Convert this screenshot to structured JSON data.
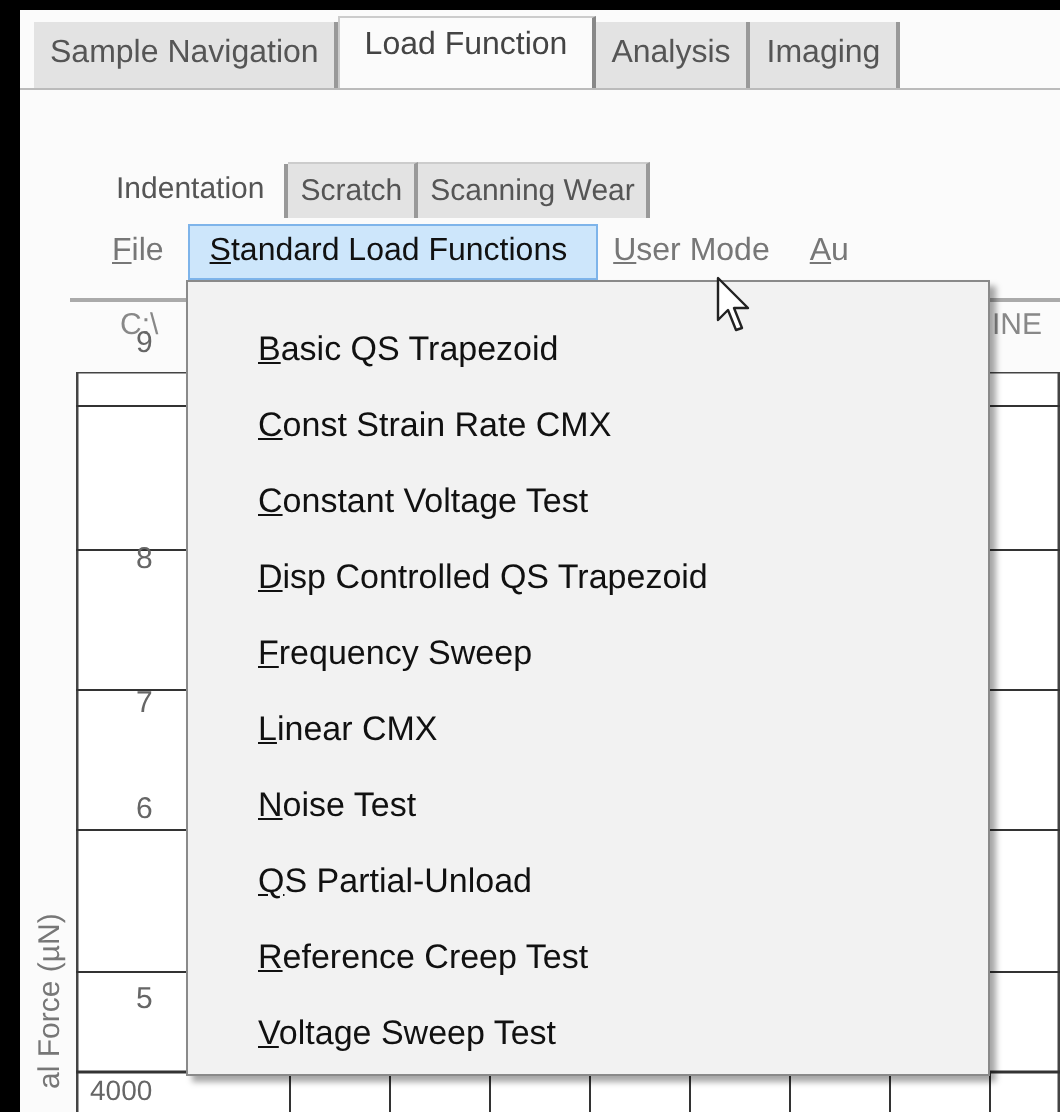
{
  "tabs": [
    {
      "label": "Sample Navigation",
      "selected": false
    },
    {
      "label": "Load Function",
      "selected": true
    },
    {
      "label": "Analysis",
      "selected": false
    },
    {
      "label": "Imaging",
      "selected": false
    }
  ],
  "sub_tabs": [
    {
      "label": "Indentation",
      "selected": true
    },
    {
      "label": "Scratch",
      "selected": false
    },
    {
      "label": "Scanning Wear",
      "selected": false
    }
  ],
  "menu_bar": [
    {
      "label": "File",
      "selected": false
    },
    {
      "label": "Standard Load Functions",
      "selected": true
    },
    {
      "label": "User Mode",
      "selected": false
    },
    {
      "label": "Au",
      "selected": false
    }
  ],
  "dropdown": [
    "Basic QS Trapezoid",
    "Const Strain Rate CMX",
    "Constant Voltage Test",
    "Disp Controlled QS Trapezoid",
    "Frequency Sweep",
    "Linear CMX",
    "Noise Test",
    "QS Partial-Unload",
    "Reference Creep Test",
    "Voltage Sweep Test"
  ],
  "background": {
    "path": "C:\\",
    "header_right": "INE",
    "y_ticks": [
      "9",
      "8",
      "7",
      "6",
      "5"
    ],
    "x_tick": "4000",
    "y_axis_label": "al Force (µN)"
  }
}
